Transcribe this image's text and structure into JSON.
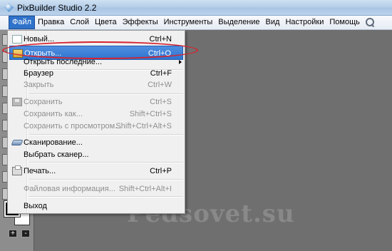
{
  "window": {
    "title": "PixBuilder Studio 2.2"
  },
  "menubar": {
    "items": [
      "Файл",
      "Правка",
      "Слой",
      "Цвета",
      "Эффекты",
      "Инструменты",
      "Выделение",
      "Вид",
      "Настройки",
      "Помощь"
    ],
    "active": "Файл",
    "search_icon": "search-icon"
  },
  "file_menu": {
    "items": [
      {
        "label": "Новый...",
        "shortcut": "Ctrl+N",
        "icon": "new-document-icon",
        "enabled": true
      },
      {
        "label": "Открыть...",
        "shortcut": "Ctrl+O",
        "icon": "open-folder-icon",
        "enabled": true,
        "highlighted": true
      },
      {
        "label": "Открыть последние...",
        "shortcut": "",
        "submenu": true,
        "enabled": true
      },
      {
        "label": "Браузер",
        "shortcut": "Ctrl+F",
        "enabled": true
      },
      {
        "label": "Закрыть",
        "shortcut": "Ctrl+W",
        "enabled": false
      },
      {
        "label": "Сохранить",
        "shortcut": "Ctrl+S",
        "icon": "save-icon",
        "enabled": false
      },
      {
        "label": "Сохранить как...",
        "shortcut": "Shift+Ctrl+S",
        "enabled": false
      },
      {
        "label": "Сохранить с просмотром...",
        "shortcut": "Shift+Ctrl+Alt+S",
        "enabled": false
      },
      {
        "label": "Сканирование...",
        "shortcut": "",
        "icon": "scanner-icon",
        "enabled": true
      },
      {
        "label": "Выбрать сканер...",
        "shortcut": "",
        "enabled": true
      },
      {
        "label": "Печать...",
        "shortcut": "Ctrl+P",
        "icon": "printer-icon",
        "enabled": true
      },
      {
        "label": "Файловая информация...",
        "shortcut": "Shift+Ctrl+Alt+I",
        "enabled": false
      },
      {
        "label": "Выход",
        "shortcut": "",
        "enabled": true
      }
    ]
  },
  "toolbox": {
    "foreground_color": "#000000",
    "background_color": "#ffffff",
    "plus_label": "+",
    "minus_label": "-"
  },
  "annotation": {
    "ring_color": "#d6232f"
  },
  "watermark": {
    "text": "Pedsovet.su"
  },
  "colors": {
    "menu_highlight": "#2f74cf",
    "active_menu": "#2f72c9",
    "workspace": "#6f6f6f"
  }
}
